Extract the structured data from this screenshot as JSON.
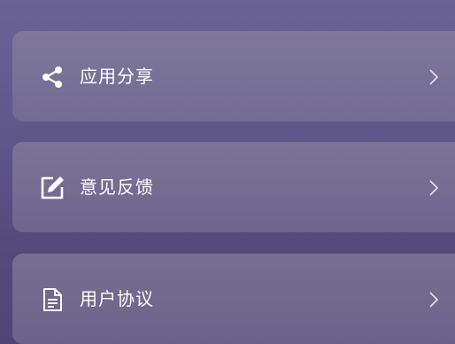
{
  "menu": {
    "items": [
      {
        "label": "应用分享",
        "icon": "share-icon"
      },
      {
        "label": "意见反馈",
        "icon": "edit-feedback-icon"
      },
      {
        "label": "用户协议",
        "icon": "document-icon"
      }
    ]
  },
  "colors": {
    "background_top": "#6b6396",
    "background_bottom": "#4f4577",
    "text": "#ffffff"
  }
}
